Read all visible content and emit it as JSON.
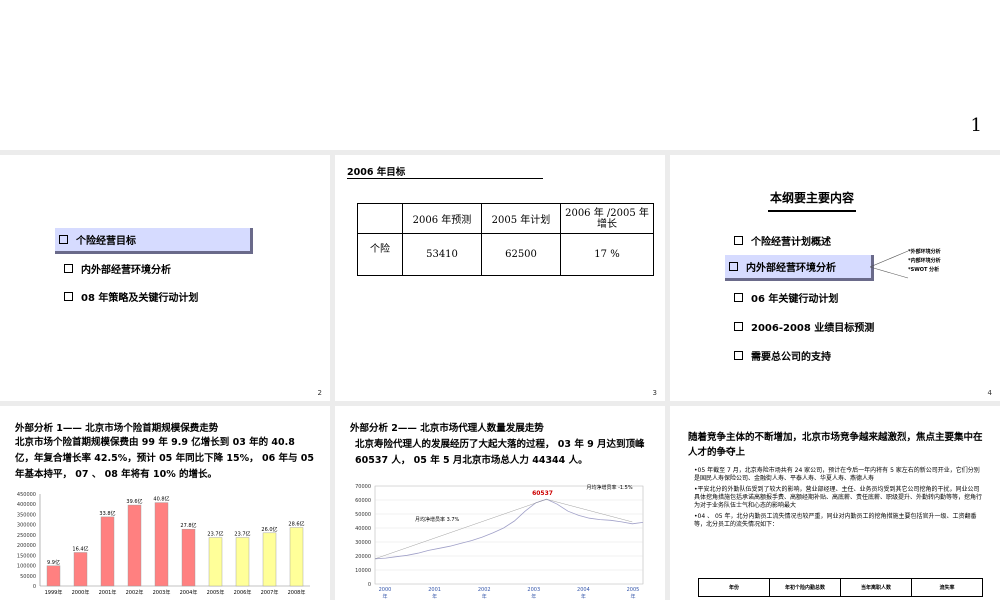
{
  "top": {
    "page_number": "1"
  },
  "slide1": {
    "items": [
      "个险经营目标",
      "内外部经营环境分析",
      "08 年策略及关键行动计划"
    ],
    "slide_number": "2"
  },
  "slide2": {
    "title": "2006 年目标",
    "table": {
      "headers": [
        "",
        "2006 年预测",
        "2005 年计划",
        "2006 年 /2005 年增长"
      ],
      "row_label": "个险",
      "values": [
        "53410",
        "62500",
        "17 %"
      ]
    },
    "slide_number": "3"
  },
  "slide3": {
    "title": "本纲要主要内容",
    "items": [
      "个险经营计划概述",
      "内外部经营环境分析",
      "06 年关键行动计划",
      "2006-2008 业绩目标预测",
      "需要总公司的支持"
    ],
    "sub_items": [
      "*外部环境分析",
      "*内部环境分析",
      "*SWOT 分析"
    ],
    "slide_number": "4"
  },
  "slide4": {
    "title": "外部分析 1—— 北京市场个险首期规模保费走势",
    "paragraph": "北京市场个险首期规模保费由 99 年 9.9 亿增长到 03 年的 40.8 亿，年复合增长率 42.5%，预计 05 年同比下降 15%， 06 年与 05 年基本持平， 07 、 08 年将有 10% 的增长。"
  },
  "slide5": {
    "title": "外部分析 2—— 北京市场代理人数量发展走势",
    "paragraph": "北京寿险代理人的发展经历了大起大落的过程， 03 年 9 月达到顶峰 60537 人， 05 年 5 月北京市场总人力 44344 人。"
  },
  "slide6": {
    "heading": "随着竞争主体的不断增加，北京市场竞争越来越激烈，焦点主要集中在人才的争夺上",
    "bullets": [
      "•05 年截至 7 月，北京寿险市场共有 24 家公司，预计在今后一年内将有 5 家左右的新公司开业，它们分别是国民人寿保险公司、金融街人寿、平泰人寿、华夏人寿、燕德人寿",
      "•平安北分的外勤队伍受到了较大的影响，营业部经理、主任、业务员均受到其它公司挖角的干扰，同业公司具体挖角措施包括承诺高额报手费、高额经期补贴、高底薪、责任底薪、职级提升、外勤转内勤等等，挖角行为对于业务队伍士气和心态的影响最大",
      "•04 、 05 年，北分内勤员工流失情况也较严重，同业对内勤员工的挖角措施主要包括官升一级、工资翻番等，北分员工的流失情况如下："
    ],
    "table_headers": [
      "年份",
      "年初个险内勤总数",
      "当年离职人数",
      "流失率"
    ]
  },
  "chart_data": [
    {
      "type": "bar",
      "categories": [
        "1999年",
        "2000年",
        "2001年",
        "2002年",
        "2003年",
        "2004年",
        "2005年",
        "2006年",
        "2007年",
        "2008年"
      ],
      "values": [
        99000,
        164000,
        338000,
        396000,
        408000,
        278000,
        237000,
        237000,
        260000,
        286000
      ],
      "data_labels": [
        "9.9亿",
        "16.4亿",
        "33.8亿",
        "39.6亿",
        "40.8亿",
        "27.8亿",
        "23.7亿",
        "23.7亿",
        "26.0亿",
        "28.6亿"
      ],
      "ylim": [
        0,
        450000
      ],
      "yticks": [
        0,
        50000,
        100000,
        150000,
        200000,
        250000,
        300000,
        350000,
        400000,
        450000
      ],
      "colors": [
        "#ff8080",
        "#ff8080",
        "#ff8080",
        "#ff8080",
        "#ff8080",
        "#ff8080",
        "#ffff99",
        "#ffff99",
        "#ffff99",
        "#ffff99"
      ]
    },
    {
      "type": "line",
      "ylim": [
        0,
        70000
      ],
      "yticks": [
        0,
        10000,
        20000,
        30000,
        40000,
        50000,
        60000,
        70000
      ],
      "xticks": [
        "2000\n年",
        "2001\n年",
        "2002\n年",
        "2003\n年",
        "2004\n年",
        "2005\n年"
      ],
      "series": [
        {
          "values": [
            18000,
            18500,
            19500,
            20500,
            22000,
            24000,
            25500,
            27000,
            29000,
            31000,
            33500,
            36500,
            40000,
            45000,
            52000,
            58000,
            60537,
            57000,
            52000,
            49000,
            47000,
            46000,
            45500,
            44344,
            43000,
            44000
          ]
        }
      ],
      "peak_label": "60537",
      "annotations": [
        "月均净增员率 3.7%",
        "月均净增员率 -1.5%"
      ]
    }
  ]
}
